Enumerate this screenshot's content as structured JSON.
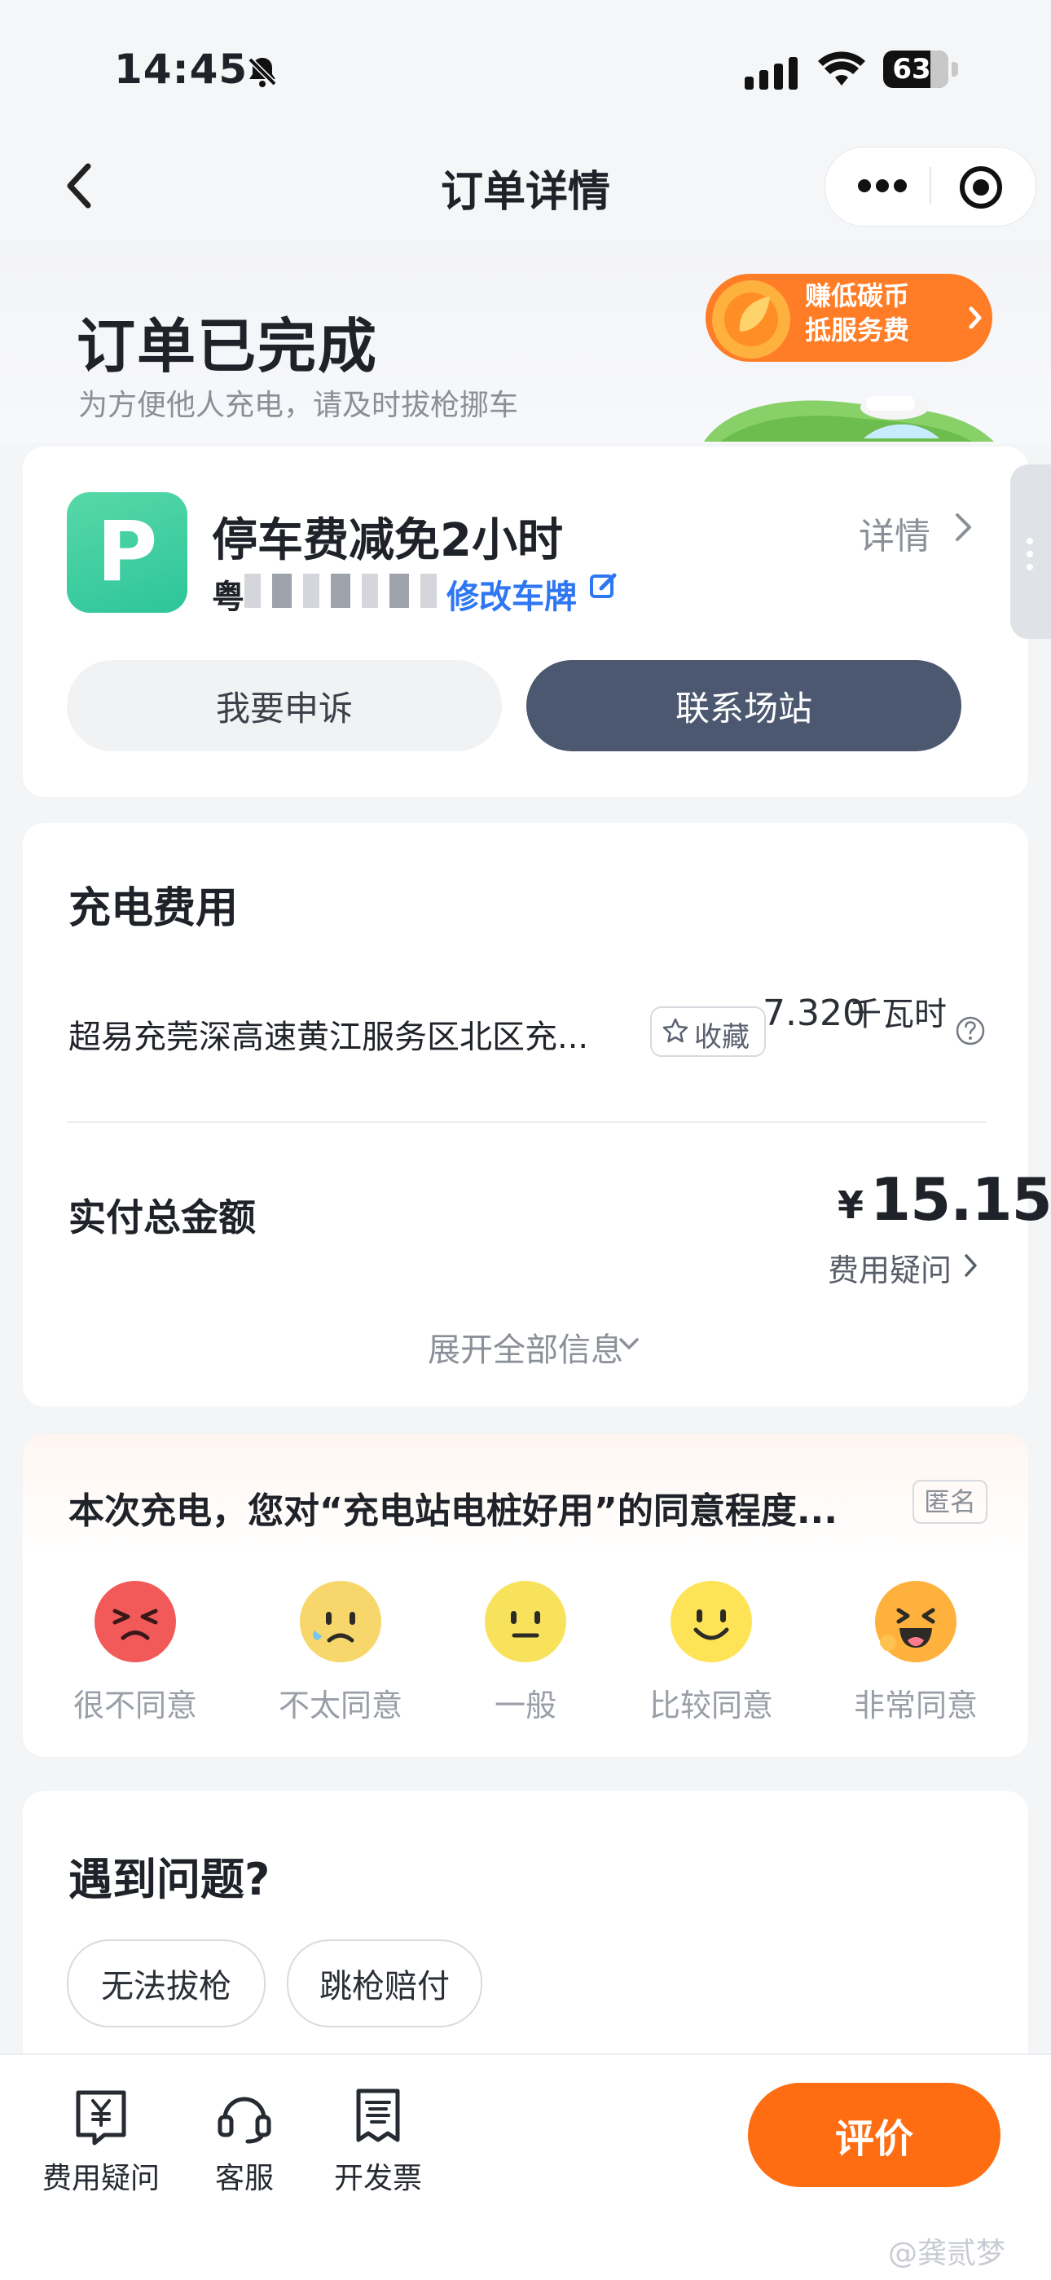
{
  "status_bar": {
    "time": "14:45",
    "battery": "63"
  },
  "nav": {
    "title": "订单详情"
  },
  "hero": {
    "title": "订单已完成",
    "subtitle": "为方便他人充电，请及时拔枪挪车",
    "promo_line1": "赚低碳币",
    "promo_line2": "抵服务费"
  },
  "parking": {
    "logo": "P",
    "title": "停车费减免2小时",
    "plate_prefix": "粤",
    "edit_plate": "修改车牌",
    "details": "详情",
    "appeal_button": "我要申诉",
    "contact_button": "联系场站"
  },
  "charging_fee": {
    "section_title": "充电费用",
    "station_name": "超易充莞深高速黄江服务区北区充...",
    "favorite": "收藏",
    "energy_value": "7.320",
    "energy_unit": "千瓦时",
    "total_label": "实付总金额",
    "currency": "¥",
    "total_amount": "15.15",
    "fee_question": "费用疑问",
    "expand_all": "展开全部信息"
  },
  "survey": {
    "question": "本次充电，您对“充电站电桩好用”的同意程度...",
    "anonymous": "匿名",
    "options": [
      {
        "label": "很不同意",
        "color": "#f25a5a"
      },
      {
        "label": "不太同意",
        "color": "#f7d76b"
      },
      {
        "label": "一般",
        "color": "#f8e25c"
      },
      {
        "label": "比较同意",
        "color": "#ffe356"
      },
      {
        "label": "非常同意",
        "color": "#ff9f43"
      }
    ]
  },
  "issues": {
    "title": "遇到问题?",
    "chips": [
      "无法拔枪",
      "跳枪赔付"
    ]
  },
  "bottom_bar": {
    "tabs": [
      {
        "label": "费用疑问",
        "icon": "receipt-yuan-icon"
      },
      {
        "label": "客服",
        "icon": "headset-icon"
      },
      {
        "label": "开发票",
        "icon": "invoice-icon"
      }
    ],
    "rate_button": "评价"
  },
  "watermark": "@龚贰梦",
  "colors": {
    "accent_orange": "#ff6d12",
    "dark_button": "#4b5870",
    "link_blue": "#2f77f2",
    "parking_green": "#2cc59a"
  }
}
